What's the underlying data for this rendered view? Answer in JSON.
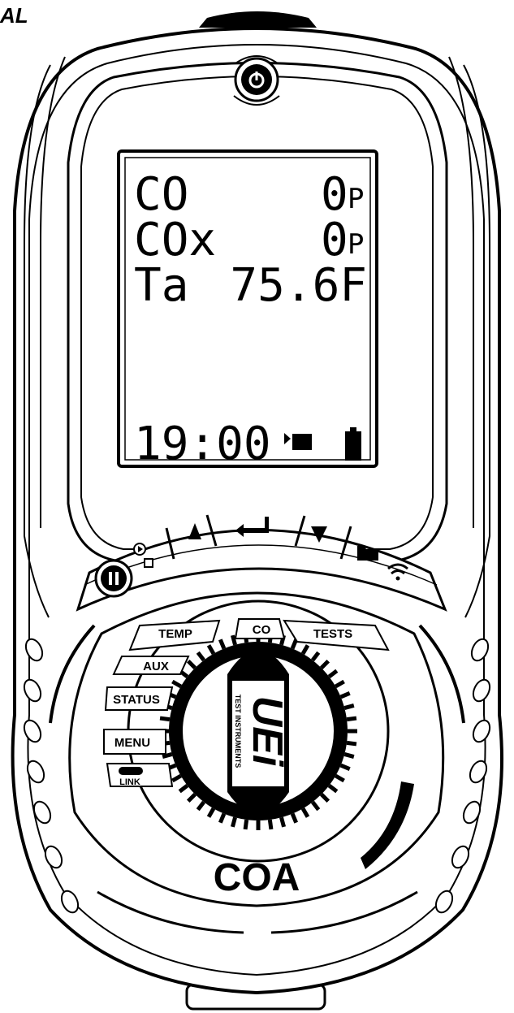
{
  "corner_text": "AL",
  "display": {
    "rows": [
      {
        "label": "CO",
        "value": "0",
        "unit": "P"
      },
      {
        "label": "COx",
        "value": "0",
        "unit": "P"
      },
      {
        "label": "Ta",
        "value": "75.6F",
        "unit": ""
      }
    ],
    "time": "19:00"
  },
  "selector": {
    "positions": [
      "TEMP",
      "CO",
      "TESTS",
      "AUX",
      "STATUS",
      "MENU"
    ],
    "link_label": "LINK"
  },
  "model": "COA",
  "brand": {
    "logo": "UEi",
    "tagline": "TEST INSTRUMENTS"
  },
  "icons": [
    "power-icon",
    "pause-icon",
    "record-icon",
    "up-arrow-icon",
    "enter-icon",
    "down-arrow-icon",
    "folder-icon",
    "wireless-icon",
    "battery-icon",
    "printer-icon"
  ]
}
